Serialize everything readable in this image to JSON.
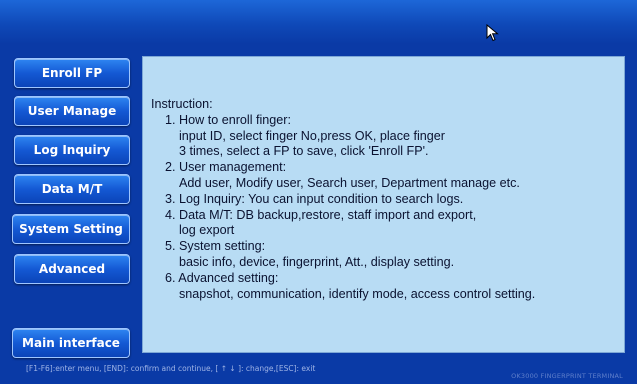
{
  "sidebar": {
    "items": [
      {
        "label": "Enroll FP"
      },
      {
        "label": "User Manage"
      },
      {
        "label": "Log Inquiry"
      },
      {
        "label": "Data M/T"
      },
      {
        "label": "System Setting"
      },
      {
        "label": "Advanced"
      }
    ],
    "main_interface": "Main interface"
  },
  "instructions": {
    "heading": "Instruction:",
    "lines": [
      "1. How to enroll finger:",
      "input ID, select finger No,press OK, place finger",
      "3 times, select a FP to save, click 'Enroll FP'.",
      "2. User management:",
      "Add user, Modify user, Search user, Department manage etc.",
      "3. Log Inquiry: You can input condition to search logs.",
      "4. Data M/T: DB backup,restore, staff import and export,",
      "log export",
      "5. System setting:",
      "basic info, device, fingerprint, Att., display setting.",
      "6. Advanced setting:",
      "snapshot, communication, identify mode, access control setting."
    ]
  },
  "footer": {
    "hint": "[F1-F6]:enter menu, [END]: confirm and continue, [ ↑ ↓ ]: change,[ESC]: exit",
    "brand": "OK3000 FINGERPRINT TERMINAL"
  },
  "colors": {
    "background": "#0a3aa6",
    "button": "#1459d4",
    "panel": "#b8dcf4"
  },
  "icons": [
    "mouse-cursor-icon"
  ]
}
